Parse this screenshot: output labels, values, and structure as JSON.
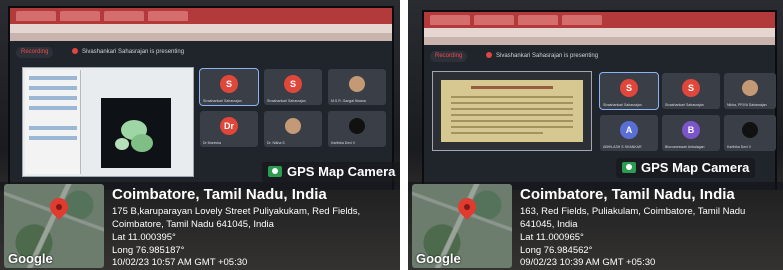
{
  "photos": [
    {
      "meet": {
        "recording_label": "Recording",
        "presenting_text": "Sivashankari Sahasrajan is presenting"
      },
      "tiles": [
        {
          "initial": "S",
          "color": "#e0463a",
          "name": "Sivashankari Sahasrajan"
        },
        {
          "initial": "S",
          "color": "#e0463a",
          "name": "Sivashankari Sahasrajan"
        },
        {
          "initial": "",
          "color": "",
          "name": "M.S.R. Gangai Nisana"
        },
        {
          "initial": "Dr",
          "color": "#e0463a",
          "name": "Dr Monisha"
        },
        {
          "initial": "",
          "color": "",
          "name": "Dr. Nikha S"
        },
        {
          "initial": "",
          "color": "",
          "name": "Karthika Devi V"
        }
      ],
      "gps_badge": "GPS Map Camera",
      "location": {
        "title": "Coimbatore, Tamil Nadu, India",
        "address_lines": [
          "175 B,karuparayan Lovely Street Puliyakukam, Red Fields,",
          "Coimbatore, Tamil Nadu 641045, India"
        ],
        "lat": "Lat 11.000395°",
        "long": "Long 76.985187°",
        "timestamp": "10/02/23 10:57 AM GMT +05:30"
      },
      "map_brand": "Google"
    },
    {
      "meet": {
        "recording_label": "Recording",
        "presenting_text": "Sivashankari Sahasrajan is presenting"
      },
      "tiles": [
        {
          "initial": "S",
          "color": "#e0463a",
          "name": "Sivashankari Sahasrajan"
        },
        {
          "initial": "S",
          "color": "#e0463a",
          "name": "Sivashankari Sahasrajan"
        },
        {
          "initial": "",
          "color": "",
          "name": "Nikha, PRIYA Sahasrajan"
        },
        {
          "initial": "A",
          "color": "#5a6fd6",
          "name": "ABHILASH S SHANKAR"
        },
        {
          "initial": "B",
          "color": "#7b55c9",
          "name": "Bhuvaneswari Anbalagan"
        },
        {
          "initial": "",
          "color": "",
          "name": "Karthika Devi V"
        }
      ],
      "gps_badge": "GPS Map Camera",
      "location": {
        "title": "Coimbatore, Tamil Nadu, India",
        "address_lines": [
          "163, Red Fields, Puliakulam, Coimbatore, Tamil Nadu",
          "641045, India"
        ],
        "lat": "Lat 11.000965°",
        "long": "Long 76.984562°",
        "timestamp": "09/02/23 10:39 AM GMT +05:30"
      },
      "map_brand": "Google"
    }
  ]
}
